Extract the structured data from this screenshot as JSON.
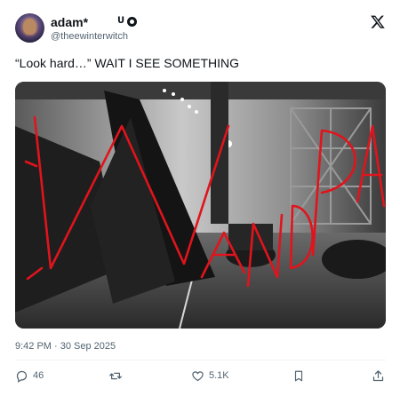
{
  "author": {
    "display_name": "adam*",
    "badge_text": "ᑌ",
    "handle": "@theewinterwitch"
  },
  "tweet": {
    "text": "“Look hard…” WAIT I SEE SOMETHING",
    "timestamp": "9:42 PM · 30 Sep 2025"
  },
  "media": {
    "description_icon": "photo",
    "scrawl_color": "#e0141c"
  },
  "actions": {
    "reply_count": "46",
    "retweet_count": "",
    "like_count": "5.1K"
  },
  "icons": {
    "logo": "x-logo-icon",
    "reply": "reply-icon",
    "retweet": "retweet-icon",
    "like": "heart-icon",
    "bookmark": "bookmark-icon",
    "share": "share-icon"
  }
}
